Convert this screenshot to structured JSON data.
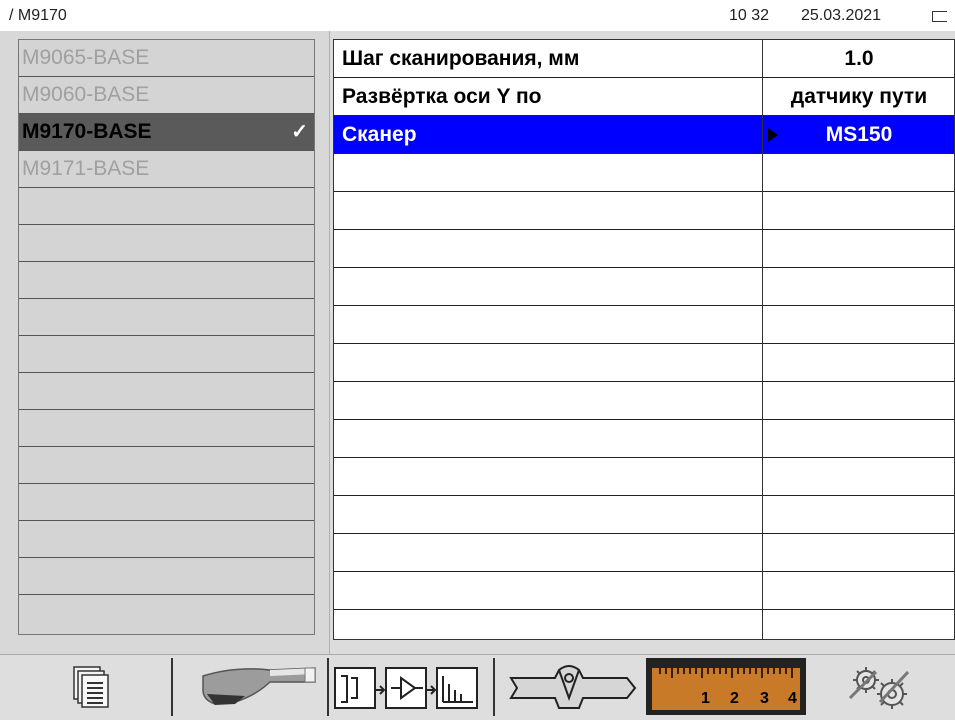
{
  "status": {
    "path": "/ M9170",
    "time": "10 32",
    "date": "25.03.2021",
    "battery_icon": "battery-icon"
  },
  "profiles": {
    "items": [
      {
        "label": "M9065-BASE",
        "selected": false
      },
      {
        "label": "M9060-BASE",
        "selected": false
      },
      {
        "label": "M9170-BASE",
        "selected": true
      },
      {
        "label": "M9171-BASE",
        "selected": false
      }
    ],
    "check_glyph": "✓",
    "empty_rows": 12
  },
  "params": {
    "rows": [
      {
        "name": "Шаг сканирования, мм",
        "value": "1.0"
      },
      {
        "name": "Развёртка оси Y по",
        "value": "датчику пути"
      },
      {
        "name": "Сканер",
        "value": "MS150",
        "active": true
      }
    ],
    "empty_rows": 12
  },
  "toolbar": {
    "buttons": [
      {
        "icon": "documents-icon"
      },
      {
        "icon": "probe-icon"
      },
      {
        "icon": "signal-chain-icon"
      },
      {
        "icon": "weld-joint-icon"
      },
      {
        "icon": "ruler-icon",
        "ruler_labels": [
          "1",
          "2",
          "3",
          "4"
        ],
        "active": true
      },
      {
        "icon": "settings-gears-icon"
      }
    ]
  },
  "colors": {
    "selection_blue": "#0000ff",
    "selected_dark": "#5a5a5a",
    "ruler_orange": "#c87a28"
  }
}
